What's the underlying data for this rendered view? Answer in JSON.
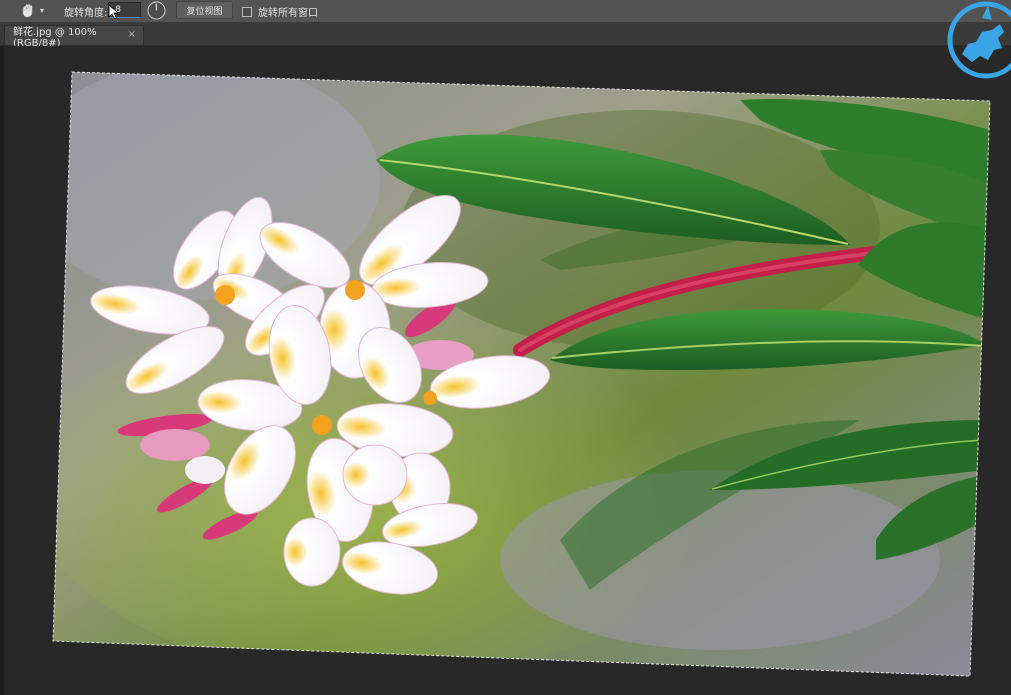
{
  "options_bar": {
    "tool_icon": "hand-rotate-icon",
    "angle_label": "旋转角度:",
    "angle_value": "-8",
    "reset_button_label": "复位视图",
    "rotate_all_label": "旋转所有窗口",
    "rotate_all_checked": false
  },
  "document": {
    "tab_label": "鲜花.jpg @ 100%(RGB/8#)",
    "close_icon": "×"
  },
  "colors": {
    "options_bg": "#535353",
    "canvas_bg": "#282828",
    "accent": "#4b8bd4",
    "logo_blue": "#3aa4e6"
  }
}
